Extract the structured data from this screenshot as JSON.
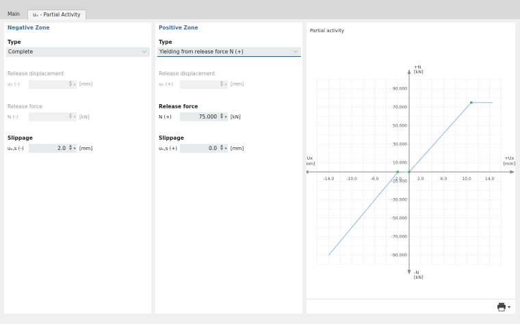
{
  "tabs": [
    {
      "label": "Main"
    },
    {
      "label": "uₓ - Partial Activity"
    }
  ],
  "negative": {
    "title": "Negative Zone",
    "type_label": "Type",
    "type_value": "Complete",
    "release_disp_label": "Release displacement",
    "release_disp_sub": "uₓ (-)",
    "release_disp_unit": "[mm]",
    "release_force_label": "Release force",
    "release_force_sub": "N (-)",
    "release_force_unit": "[kN]",
    "slippage_label": "Slippage",
    "slippage_sub": "uₓ,s (-)",
    "slippage_value": "2.0",
    "slippage_unit": "[mm]"
  },
  "positive": {
    "title": "Positive Zone",
    "type_label": "Type",
    "type_value": "Yielding from release force N (+)",
    "release_disp_label": "Release displacement",
    "release_disp_sub": "uₓ (+)",
    "release_disp_unit": "[mm]",
    "release_force_label": "Release force",
    "release_force_sub": "N (+)",
    "release_force_value": "75.000",
    "release_force_unit": "[kN]",
    "slippage_label": "Slippage",
    "slippage_sub": "uₓ,s (+)",
    "slippage_value": "0.0",
    "slippage_unit": "[mm]"
  },
  "chart_data": {
    "type": "line",
    "title": "Partial activity",
    "x_neg_label": "-Ux",
    "x_pos_label": "+Ux",
    "x_unit": "[mm]",
    "y_pos_label": "+N",
    "y_neg_label": "-N",
    "y_unit": "[kN]",
    "x_ticks": [
      "-14.0",
      "-10.0",
      "-6.0",
      "-2.0",
      "2.0",
      "6.0",
      "10.0",
      "14.0"
    ],
    "x_tick_values": [
      -14,
      -10,
      -6,
      -2,
      2,
      6,
      10,
      14
    ],
    "y_ticks": [
      "90.000",
      "70.000",
      "50.000",
      "30.000",
      "10.000",
      "-10.000",
      "-30.000",
      "-50.000",
      "-70.000",
      "-90.000"
    ],
    "y_tick_values": [
      90,
      70,
      50,
      30,
      10,
      -10,
      -30,
      -50,
      -70,
      -90
    ],
    "xlim": [
      -16,
      16
    ],
    "ylim": [
      -100,
      100
    ],
    "grid": true,
    "series": [
      {
        "x": [
          -14.0,
          -2.0,
          0.0,
          10.8,
          14.5
        ],
        "y": [
          -90,
          -0.5,
          0,
          75,
          75
        ]
      }
    ],
    "markers": [
      {
        "x": -2.0,
        "y": 0
      },
      {
        "x": 0.0,
        "y": 0
      },
      {
        "x": 10.8,
        "y": 75
      }
    ],
    "line_color": "#9fc5e8",
    "marker_color": "#4caf50",
    "axis_color": "#8a8a8a"
  }
}
